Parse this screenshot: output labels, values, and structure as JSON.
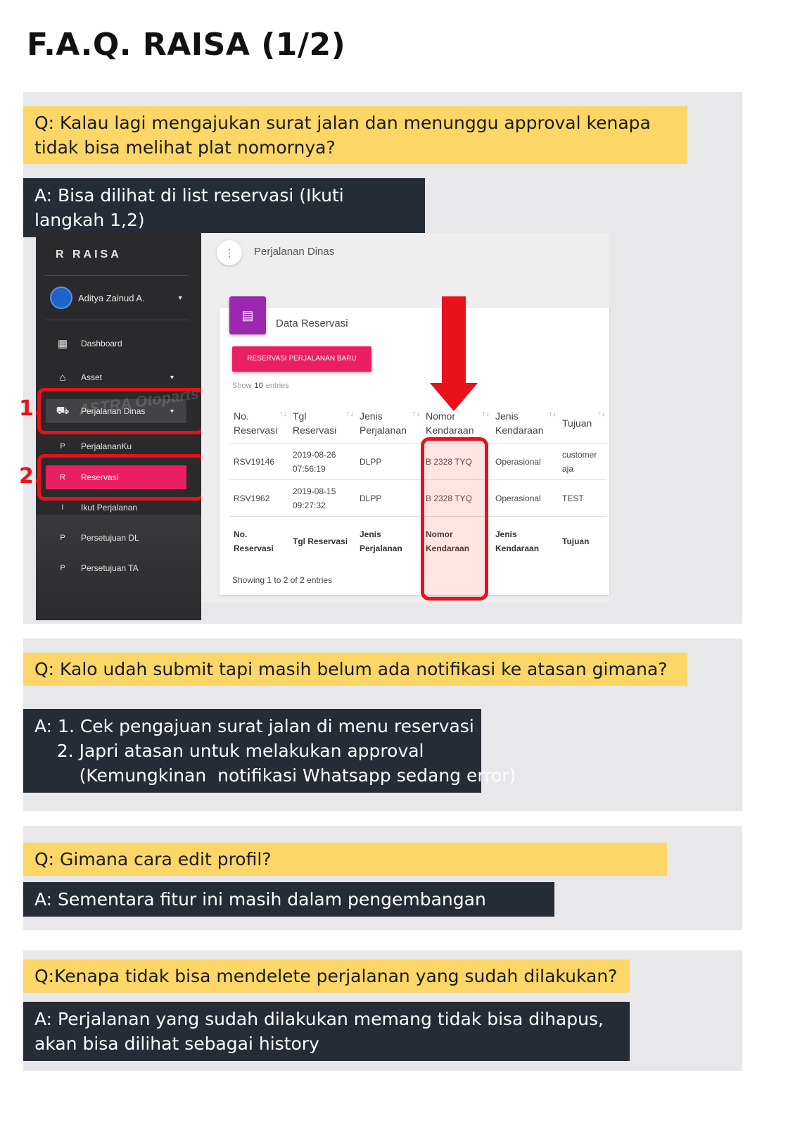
{
  "page_title": "F.A.Q. RAISA (1/2)",
  "faq": [
    {
      "question": "Q: Kalau lagi mengajukan surat jalan dan menunggu approval kenapa tidak bisa melihat plat nomornya?",
      "answer": "A: Bisa dilihat di list reservasi (Ikuti langkah 1,2)"
    },
    {
      "question": "Q: Kalo udah submit tapi masih belum ada notifikasi ke atasan gimana?",
      "answer_lines": [
        "A: 1. Cek pengajuan surat jalan di menu reservasi",
        "    2. Japri atasan untuk melakukan approval",
        "        (Kemungkinan  notifikasi Whatsapp sedang error)"
      ]
    },
    {
      "question": "Q: Gimana cara edit profil?",
      "answer": "A: Sementara fitur ini masih dalam pengembangan"
    },
    {
      "question": "Q:Kenapa tidak bisa mendelete perjalanan yang sudah dilakukan?",
      "answer": "A: Perjalanan yang sudah dilakukan memang tidak bisa dihapus, akan bisa dilihat sebagai history"
    }
  ],
  "screenshot": {
    "brand": "R   RAISA",
    "user_name": "Aditya Zainud A.",
    "bg_text": "ASTRA Otoparts",
    "menu": [
      {
        "icon": "▦",
        "label": "Dashboard"
      },
      {
        "icon": "🏛",
        "label": "Asset",
        "caret": "▾"
      },
      {
        "icon": "🚗",
        "label": "Perjalanan Dinas",
        "caret": "▾"
      },
      {
        "letter": "P",
        "label": "PerjalananKu"
      },
      {
        "letter": "R",
        "label": "Reservasi"
      },
      {
        "letter": "I",
        "label": "Ikut Perjalanan"
      },
      {
        "letter": "P",
        "label": "Persetujuan DL"
      },
      {
        "letter": "P",
        "label": "Persetujuan TA"
      }
    ],
    "step_labels": [
      "1.",
      "2."
    ],
    "topbar_title": "Perjalanan Dinas",
    "card_title": "Data Reservasi",
    "new_button": "RESERVASI PERJALANAN BARU",
    "show_prefix": "Show",
    "show_count": "10",
    "show_suffix": "entries",
    "columns": [
      "No. Reservasi",
      "Tgl Reservasi",
      "Jenis Perjalanan",
      "Nomor Kendaraan",
      "Jenis Kendaraan",
      "Tujuan"
    ],
    "rows": [
      [
        "RSV19146",
        "2019-08-26 07:56:19",
        "DLPP",
        "B 2328 TYQ",
        "Operasional",
        "customer aja"
      ],
      [
        "RSV1962",
        "2019-08-15 09:27:32",
        "DLPP",
        "B 2328 TYQ",
        "Operasional",
        "TEST"
      ]
    ],
    "footer_columns": [
      "No. Reservasi",
      "Tgl Reservasi",
      "Jenis Perjalanan",
      "Nomor Kendaraan",
      "Jenis Kendaraan",
      "Tujuan"
    ],
    "showing": "Showing 1 to 2 of 2 entries"
  },
  "colors": {
    "question_bg": "#fcd666",
    "answer_bg": "#262c35",
    "section_bg": "#e8e7e9",
    "highlight_red": "#e8111c",
    "accent_pink": "#e91e63",
    "card_icon": "#9c27b0"
  }
}
